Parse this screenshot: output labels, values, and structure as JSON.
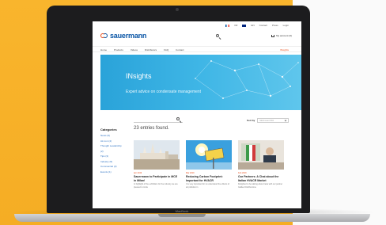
{
  "site": {
    "logo_text": "sauermann",
    "top_links": [
      "FR",
      "EN",
      "Contact",
      "Press",
      "Login"
    ],
    "account_label": "My account (0)",
    "nav": [
      "Home",
      "Products",
      "Videos",
      "Distributors",
      "FAQ",
      "Contact"
    ],
    "nav_right": "INsights"
  },
  "hero": {
    "title": "INsights",
    "subtitle": "Expert advice on condensate management"
  },
  "listing": {
    "search_placeholder": "",
    "results_count": "23 entries found.",
    "sort_label": "Sort by",
    "sort_value": "Most recent first",
    "sidebar_title": "Categories",
    "categories": [
      "News (6)",
      "Air-con (4)",
      "Thought Leadership",
      "(2)",
      "Tips (3)",
      "Industry (5)",
      "Commercial (2)",
      "Events (1)"
    ]
  },
  "cards": [
    {
      "date": "Apr 2019",
      "title": "Sauermann to Participate in MCE in Milan!",
      "excerpt": "In highlight of the exhibition for the industry we are pleased to invite"
    },
    {
      "date": "Mar 2019",
      "title": "Reducing Carbon Footprint: Important for HVACR",
      "excerpt": "It is very important for to understand the effects of air pollution in"
    },
    {
      "date": "Feb 2019",
      "title": "Our Partners: A Chat about the Italian HVACR Market",
      "excerpt": "Delighted to be talking about trade with our partner Galileo Distribuzione"
    }
  ],
  "device": {
    "brand_label": "MacBook"
  },
  "colors": {
    "background": "#f5ad24",
    "brand_blue": "#0a56a6",
    "brand_orange": "#e84e1b",
    "hero_blue": "#3fb6e6"
  }
}
